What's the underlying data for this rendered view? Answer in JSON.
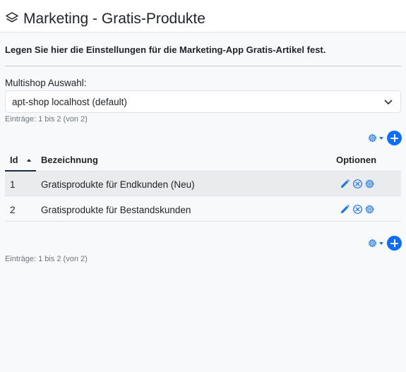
{
  "header": {
    "title": "Marketing - Gratis-Produkte",
    "icon": "layers-icon"
  },
  "intro": "Legen Sie hier die Einstellungen für die Marketing-App Gratis-Artikel fest.",
  "multishop": {
    "label": "Multishop Auswahl:",
    "selected": "apt-shop localhost (default)"
  },
  "entries_text": "Einträge: 1 bis 2 (von 2)",
  "table": {
    "columns": {
      "id": "Id",
      "name": "Bezeichnung",
      "options": "Optionen"
    },
    "sort": {
      "column": "Id",
      "direction": "ascending"
    },
    "rows": [
      {
        "id": "1",
        "name": "Gratisprodukte für Endkunden (Neu)"
      },
      {
        "id": "2",
        "name": "Gratisprodukte für Bestandskunden"
      }
    ],
    "row_actions": [
      "edit-icon",
      "delete-icon",
      "settings-icon"
    ]
  },
  "colors": {
    "accent": "#0d6efd",
    "icon_blue": "#1a73e8",
    "row_stripe": "#eaebec",
    "background": "#f8f9fa"
  }
}
